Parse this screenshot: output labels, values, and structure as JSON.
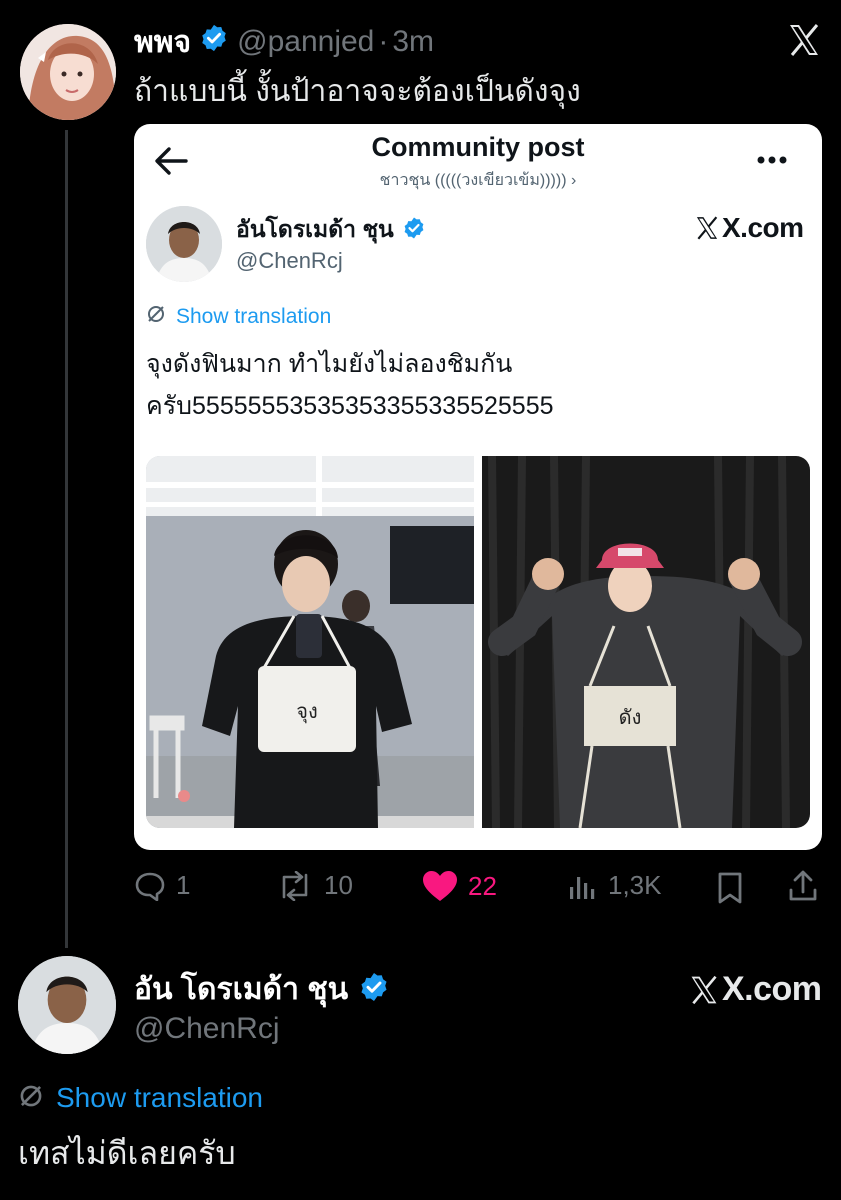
{
  "tweet": {
    "display_name": "พพจ",
    "handle": "@pannjed",
    "separator": "·",
    "time": "3m",
    "text": "ถ้าแบบนี้ งั้นป้าอาจจะต้องเป็นดังจุง",
    "close_icon": "x-logo-icon"
  },
  "quoted_card": {
    "header_title": "Community post",
    "community_name": "ชาวชุน (((((วงเขียวเข้ม))))) ›",
    "author_name": "อันโดรเมด้า ชุน",
    "author_handle": "@ChenRcj",
    "brand": "X.com",
    "translate_label": "Show translation",
    "post_line1": "จุงดังฟินมาก ทำไมยังไม่ลองชิมกัน",
    "post_line2": "ครับ55555553535353355335525555",
    "photo_left_label": "จุง",
    "photo_right_label": "ดัง"
  },
  "actions": {
    "replies": "1",
    "reposts": "10",
    "likes": "22",
    "views": "1,3K"
  },
  "reply": {
    "display_name": "อัน โดรเมด้า ชุน",
    "handle": "@ChenRcj",
    "brand": "X.com",
    "translate_label": "Show translation",
    "text": "เทสไม่ดีเลยครับ"
  },
  "colors": {
    "background": "#000000",
    "verified": "#1d9bf0",
    "like": "#f91880",
    "link": "#1d9bf0"
  }
}
